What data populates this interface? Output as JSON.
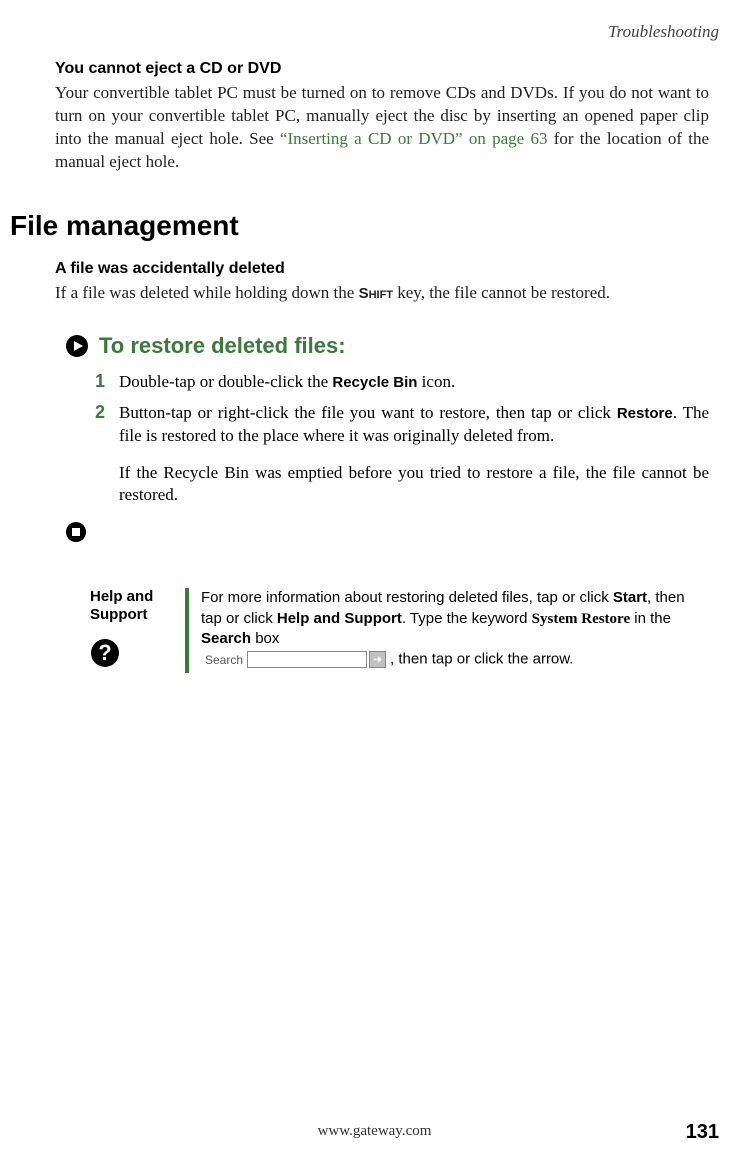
{
  "header": {
    "section": "Troubleshooting"
  },
  "topic1": {
    "heading": "You cannot eject a CD or DVD",
    "body_pre": "Your convertible tablet PC must be turned on to remove CDs and DVDs. If you do not want to turn on your convertible tablet PC, manually eject the disc by inserting an opened paper clip into the manual eject hole. See ",
    "link": "“Inserting a CD or DVD” on page 63",
    "body_post": " for the location of the manual eject hole."
  },
  "section_heading": "File management",
  "topic2": {
    "heading": "A file was accidentally deleted",
    "body_pre": "If a file was deleted while holding down the ",
    "key": "Shift",
    "body_post": " key, the file cannot be restored."
  },
  "procedure": {
    "title": "To restore deleted files:",
    "steps": [
      {
        "num": "1",
        "pre": "Double-tap or double-click the ",
        "ui": "Recycle Bin",
        "post": " icon."
      },
      {
        "num": "2",
        "pre": "Button-tap or right-click the file you want to restore, then tap or click ",
        "ui": "Restore",
        "post": ". The file is restored to the place where it was originally deleted from."
      }
    ],
    "note": "If the Recycle Bin was emptied before you tried to restore a file, the file cannot be restored."
  },
  "help": {
    "label_line1": "Help and",
    "label_line2": "Support",
    "text_pre": "For more information about restoring deleted files, tap or click ",
    "ui1": "Start",
    "mid1": ", then tap or click ",
    "ui2": "Help and Support",
    "mid2": ". Type the keyword ",
    "keyword": "System Restore",
    "mid3": " in the ",
    "ui3": "Search",
    "mid4": " box",
    "search_label": "Search",
    "text_post": ", then tap or click the arrow."
  },
  "footer": {
    "url": "www.gateway.com",
    "page": "131"
  }
}
